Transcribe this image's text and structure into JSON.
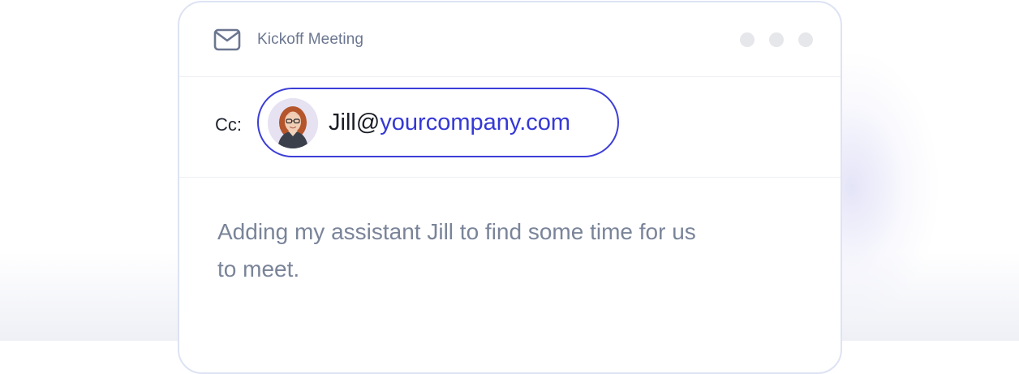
{
  "email": {
    "subject": "Kickoff Meeting",
    "cc_label": "Cc:",
    "cc_recipient": {
      "user": "Jill@",
      "domain": "yourcompany.com"
    },
    "body_text": "Adding my assistant Jill to find some time for us to meet."
  },
  "icons": {
    "mail": "mail-envelope-icon",
    "window_controls": [
      "window-dot-icon",
      "window-dot-icon",
      "window-dot-icon"
    ]
  },
  "colors": {
    "accent": "#3c3ed8",
    "domain_text": "#3538d6",
    "muted_text": "#7a8499",
    "border": "#dde3f3"
  }
}
